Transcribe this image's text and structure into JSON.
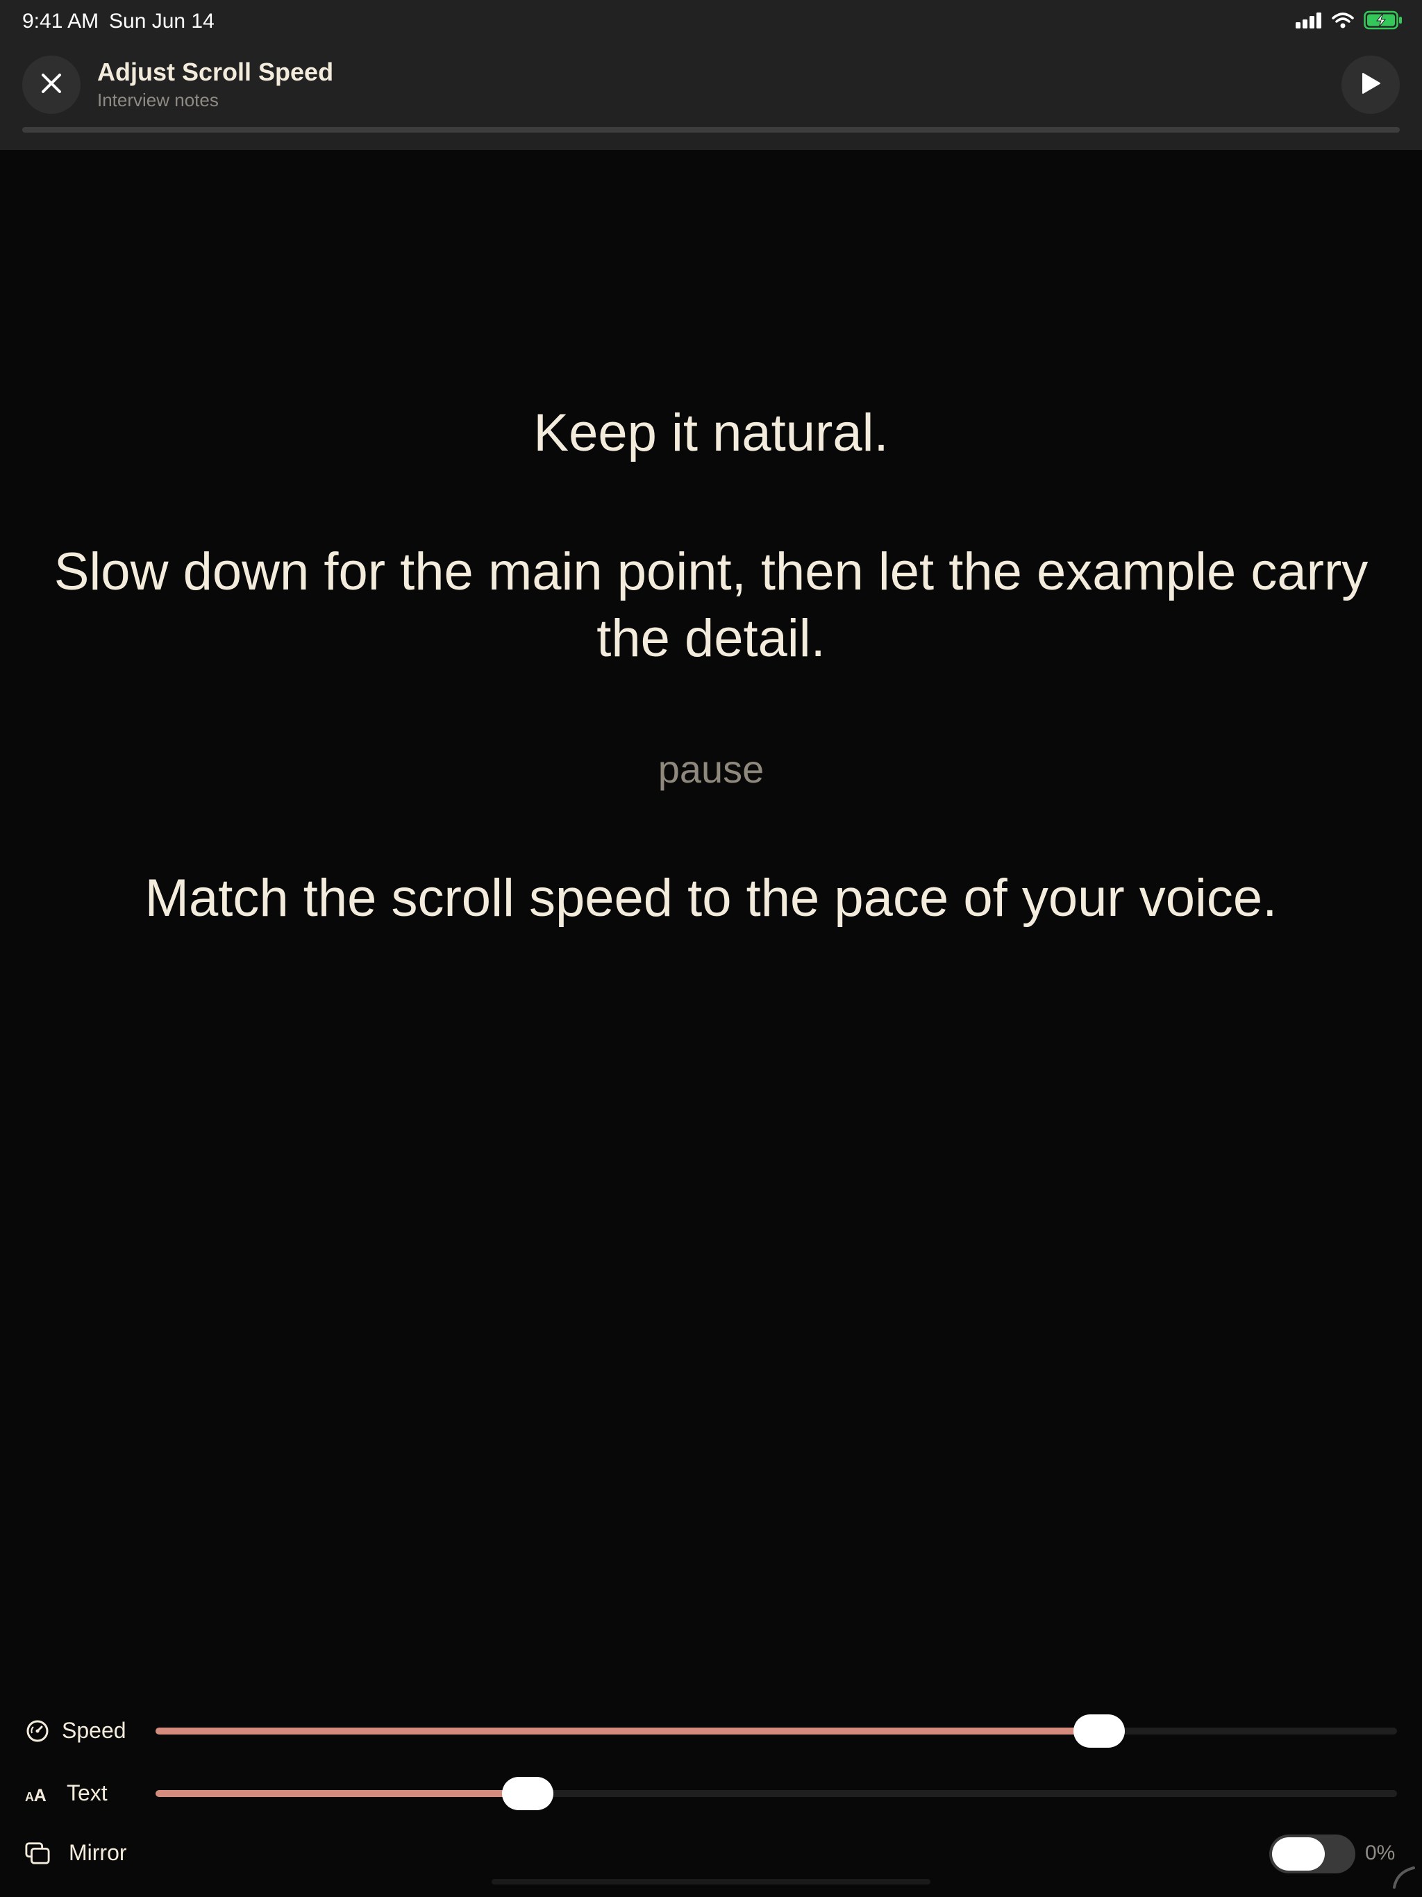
{
  "status_bar": {
    "time": "9:41 AM",
    "date": "Sun Jun 14",
    "icons": [
      "cellular-signal-icon",
      "wifi-icon",
      "battery-charging-icon"
    ]
  },
  "header": {
    "title": "Adjust Scroll Speed",
    "subtitle": "Interview notes",
    "close_icon": "close-icon",
    "play_icon": "play-icon",
    "progress": 0
  },
  "script": {
    "lines": [
      "Keep it natural.",
      "Slow down for the main point, then let the example carry the detail.",
      "pause",
      "Match the scroll speed to the pace of your voice."
    ]
  },
  "controls": {
    "speed": {
      "label": "Speed",
      "icon": "speedometer-icon",
      "value": 0.76
    },
    "text": {
      "label": "Text",
      "icon": "text-size-icon",
      "value": 0.3
    },
    "mirror": {
      "label": "Mirror",
      "icon": "mirror-icon",
      "toggle_on": false,
      "value_text": "0%"
    }
  },
  "colors": {
    "background": "#080808",
    "header_bg": "#222222",
    "accent": "#d48c7f",
    "text": "#f3ecdc",
    "muted": "#8f887d",
    "battery_green": "#34c759"
  }
}
